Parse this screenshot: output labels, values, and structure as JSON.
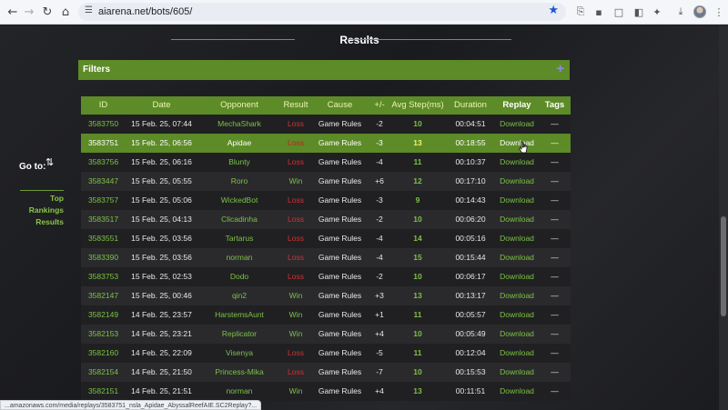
{
  "browser": {
    "url": "aiarena.net/bots/605/",
    "status_url": "...amazonaws.com/media/replays/3583751_nsla_Apidae_AbyssalReefAIE.SC2Replay?..."
  },
  "page": {
    "results_title": "Results",
    "filters_label": "Filters",
    "filters_toggle": "+",
    "goto_label": "Go to:",
    "sort_icon": "⇅",
    "side_links": [
      "Top",
      "Rankings",
      "Results"
    ]
  },
  "table": {
    "headers": [
      "ID",
      "Date",
      "Opponent",
      "Result",
      "Cause",
      "+/-",
      "Avg Step(ms)",
      "Duration",
      "Replay",
      "Tags"
    ],
    "rows": [
      {
        "id": "3583750",
        "date": "15 Feb. 25, 07:44",
        "opponent": "MechaShark",
        "result": "Loss",
        "cause": "Game Rules",
        "pm": "-2",
        "avg": "10",
        "duration": "00:04:51",
        "replay": "Download",
        "tags": "—"
      },
      {
        "id": "3583751",
        "date": "15 Feb. 25, 06:56",
        "opponent": "Apidae",
        "result": "Loss",
        "cause": "Game Rules",
        "pm": "-3",
        "avg": "13",
        "duration": "00:18:55",
        "replay": "Download",
        "tags": "—"
      },
      {
        "id": "3583756",
        "date": "15 Feb. 25, 06:16",
        "opponent": "Blunty",
        "result": "Loss",
        "cause": "Game Rules",
        "pm": "-4",
        "avg": "11",
        "duration": "00:10:37",
        "replay": "Download",
        "tags": "—"
      },
      {
        "id": "3583447",
        "date": "15 Feb. 25, 05:55",
        "opponent": "Roro",
        "result": "Win",
        "cause": "Game Rules",
        "pm": "+6",
        "avg": "12",
        "duration": "00:17:10",
        "replay": "Download",
        "tags": "—"
      },
      {
        "id": "3583757",
        "date": "15 Feb. 25, 05:06",
        "opponent": "WickedBot",
        "result": "Loss",
        "cause": "Game Rules",
        "pm": "-3",
        "avg": "9",
        "duration": "00:14:43",
        "replay": "Download",
        "tags": "—"
      },
      {
        "id": "3583517",
        "date": "15 Feb. 25, 04:13",
        "opponent": "Clicadinha",
        "result": "Loss",
        "cause": "Game Rules",
        "pm": "-2",
        "avg": "10",
        "duration": "00:06:20",
        "replay": "Download",
        "tags": "—"
      },
      {
        "id": "3583551",
        "date": "15 Feb. 25, 03:56",
        "opponent": "Tartarus",
        "result": "Loss",
        "cause": "Game Rules",
        "pm": "-4",
        "avg": "14",
        "duration": "00:05:16",
        "replay": "Download",
        "tags": "—"
      },
      {
        "id": "3583390",
        "date": "15 Feb. 25, 03:56",
        "opponent": "norman",
        "result": "Loss",
        "cause": "Game Rules",
        "pm": "-4",
        "avg": "15",
        "duration": "00:15:44",
        "replay": "Download",
        "tags": "—"
      },
      {
        "id": "3583753",
        "date": "15 Feb. 25, 02:53",
        "opponent": "Dodo",
        "result": "Loss",
        "cause": "Game Rules",
        "pm": "-2",
        "avg": "10",
        "duration": "00:06:17",
        "replay": "Download",
        "tags": "—"
      },
      {
        "id": "3582147",
        "date": "15 Feb. 25, 00:46",
        "opponent": "qin2",
        "result": "Win",
        "cause": "Game Rules",
        "pm": "+3",
        "avg": "13",
        "duration": "00:13:17",
        "replay": "Download",
        "tags": "—"
      },
      {
        "id": "3582149",
        "date": "14 Feb. 25, 23:57",
        "opponent": "HarstemsAunt",
        "result": "Win",
        "cause": "Game Rules",
        "pm": "+1",
        "avg": "11",
        "duration": "00:05:57",
        "replay": "Download",
        "tags": "—"
      },
      {
        "id": "3582153",
        "date": "14 Feb. 25, 23:21",
        "opponent": "Replicator",
        "result": "Win",
        "cause": "Game Rules",
        "pm": "+4",
        "avg": "10",
        "duration": "00:05:49",
        "replay": "Download",
        "tags": "—"
      },
      {
        "id": "3582160",
        "date": "14 Feb. 25, 22:09",
        "opponent": "Visenya",
        "result": "Loss",
        "cause": "Game Rules",
        "pm": "-5",
        "avg": "11",
        "duration": "00:12:04",
        "replay": "Download",
        "tags": "—"
      },
      {
        "id": "3582154",
        "date": "14 Feb. 25, 21:50",
        "opponent": "Princess-Mika",
        "result": "Loss",
        "cause": "Game Rules",
        "pm": "-7",
        "avg": "10",
        "duration": "00:15:53",
        "replay": "Download",
        "tags": "—"
      },
      {
        "id": "3582151",
        "date": "14 Feb. 25, 21:51",
        "opponent": "norman",
        "result": "Win",
        "cause": "Game Rules",
        "pm": "+4",
        "avg": "13",
        "duration": "00:11:51",
        "replay": "Download",
        "tags": "—"
      }
    ],
    "highlighted_row": 1
  }
}
